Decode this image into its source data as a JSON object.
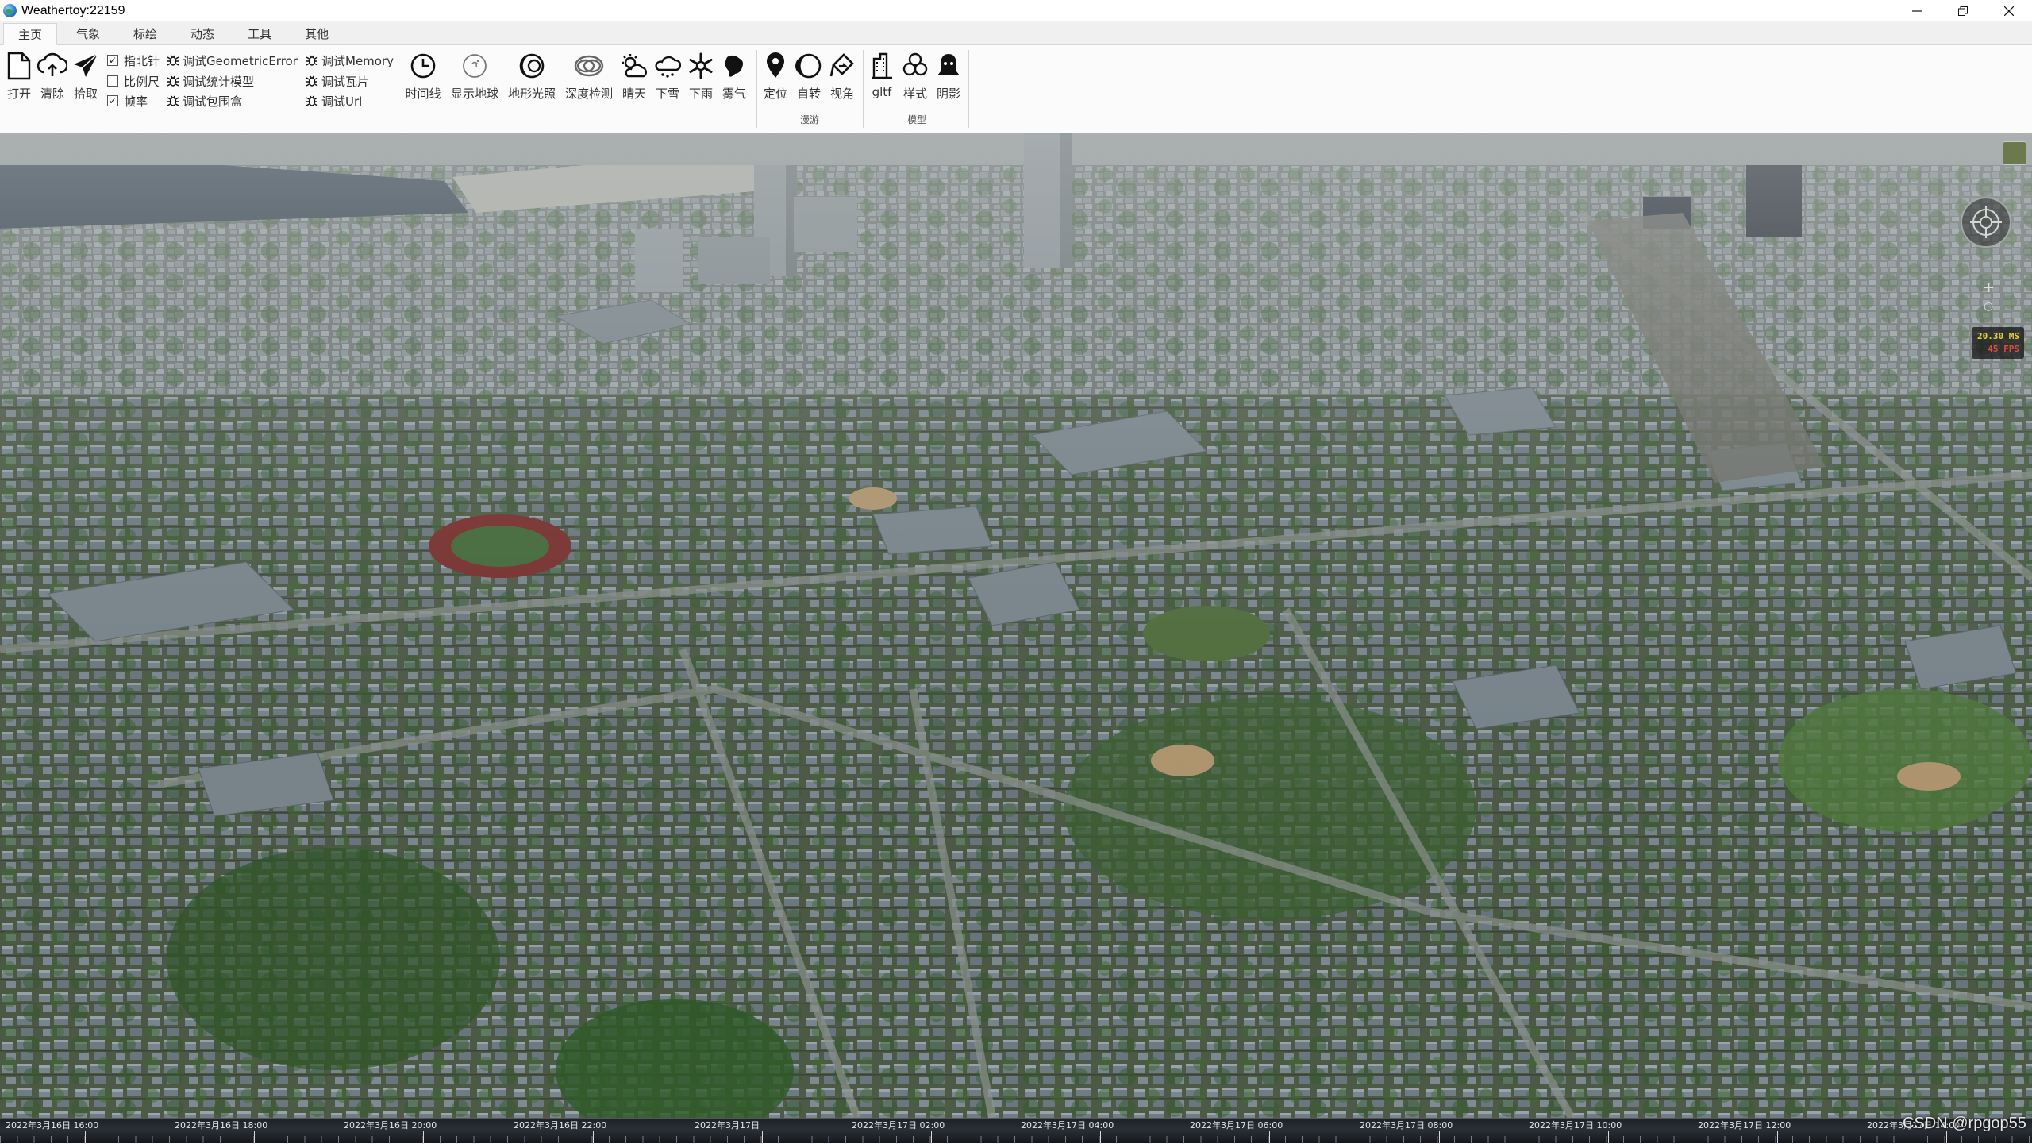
{
  "window": {
    "title": "Weathertoy:22159",
    "controls": [
      "minimize-icon",
      "restore-icon",
      "close-icon"
    ]
  },
  "ribbon": {
    "tabs": [
      {
        "label": "主页",
        "active": true
      },
      {
        "label": "气象"
      },
      {
        "label": "标绘"
      },
      {
        "label": "动态"
      },
      {
        "label": "工具"
      },
      {
        "label": "其他"
      }
    ],
    "buttons": {
      "open": "打开",
      "clear": "清除",
      "pick": "拾取",
      "timeline": "时间线",
      "show_globe": "显示地球",
      "terrain_light": "地形光照",
      "depth_test": "深度检测",
      "sunny": "晴天",
      "snow": "下雪",
      "rain": "下雨",
      "fog": "雾气",
      "locate": "定位",
      "rotate": "自转",
      "view_angle": "视角",
      "gltf": "gltf",
      "style": "样式",
      "shadow": "阴影"
    },
    "checkboxes": {
      "compass": {
        "label": "指北针",
        "checked": true
      },
      "scale": {
        "label": "比例尺",
        "checked": false
      },
      "framerate": {
        "label": "帧率",
        "checked": true
      }
    },
    "debug": {
      "geometric_error": "调试GeometricError",
      "stats_model": "调试统计模型",
      "bounding_box": "调试包围盒",
      "memory": "调试Memory",
      "tiles": "调试瓦片",
      "url": "调试Url"
    },
    "groups": {
      "roam": "漫游",
      "model": "模型"
    }
  },
  "viewport": {
    "fps_ms": "20.30 MS",
    "fps_value": "45 FPS",
    "zoom_plus": "+",
    "zoom_minus": "○"
  },
  "timeline": {
    "labels": [
      "2022年3月16日 16:00",
      "2022年3月16日 18:00",
      "2022年3月16日 20:00",
      "2022年3月16日 22:00",
      "2022年3月17日",
      "2022年3月17日 02:00",
      "2022年3月17日 04:00",
      "2022年3月17日 06:00",
      "2022年3月17日 08:00",
      "2022年3月17日 10:00",
      "2022年3月17日 12:00",
      "2022年3月17日 14:00"
    ]
  },
  "watermark": "CSDN @rpgop55",
  "colors": {
    "ribbon_bg": "#fbfbfb",
    "tabs_bg": "#f0f0f0",
    "timeline_bg": "#1d2127",
    "fps_ms": "#e7d23a",
    "fps_fps": "#e7493a"
  }
}
